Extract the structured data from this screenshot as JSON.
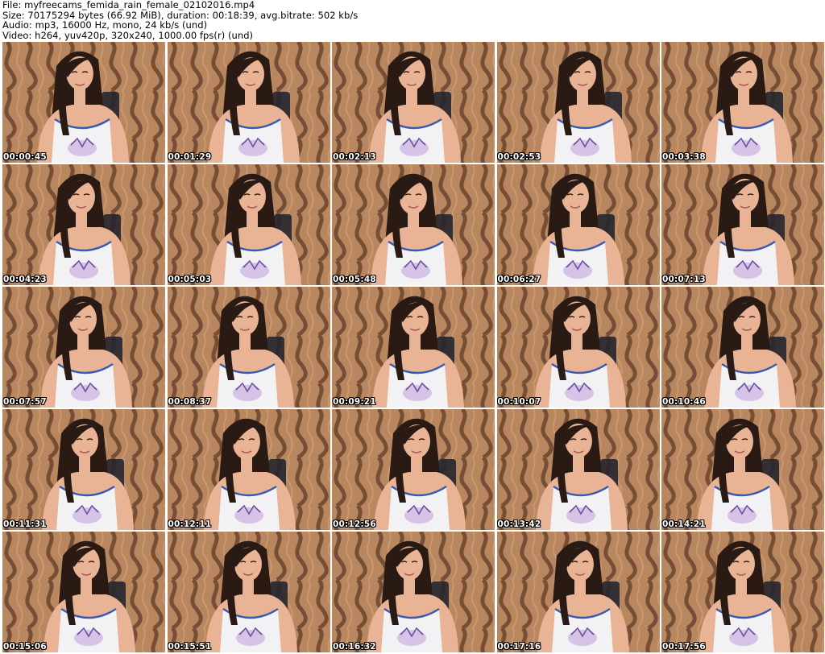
{
  "header": {
    "file_line": "File: myfreecams_femida_rain_female_02102016.mp4",
    "size_line": "Size: 70175294 bytes (66.92 MiB), duration: 00:18:39, avg.bitrate: 502 kb/s",
    "audio_line": "Audio: mp3, 16000 Hz, mono, 24 kb/s (und)",
    "video_line": "Video: h264, yuv420p, 320x240, 1000.00 fps(r) (und)"
  },
  "colors": {
    "wallpaper_base": "#b8865f",
    "wallpaper_stripe": "#5e3a26",
    "hair": "#2a1a14",
    "skin": "#e9b495",
    "shirt": "#f2f2f4",
    "shirt_trim": "#3a5ab0",
    "chair": "#26262e"
  },
  "thumbnails": [
    {
      "timestamp": "00:00:45"
    },
    {
      "timestamp": "00:01:29"
    },
    {
      "timestamp": "00:02:13"
    },
    {
      "timestamp": "00:02:53"
    },
    {
      "timestamp": "00:03:38"
    },
    {
      "timestamp": "00:04:23"
    },
    {
      "timestamp": "00:05:03"
    },
    {
      "timestamp": "00:05:48"
    },
    {
      "timestamp": "00:06:27"
    },
    {
      "timestamp": "00:07:13"
    },
    {
      "timestamp": "00:07:57"
    },
    {
      "timestamp": "00:08:37"
    },
    {
      "timestamp": "00:09:21"
    },
    {
      "timestamp": "00:10:07"
    },
    {
      "timestamp": "00:10:46"
    },
    {
      "timestamp": "00:11:31"
    },
    {
      "timestamp": "00:12:11"
    },
    {
      "timestamp": "00:12:56"
    },
    {
      "timestamp": "00:13:42"
    },
    {
      "timestamp": "00:14:21"
    },
    {
      "timestamp": "00:15:06"
    },
    {
      "timestamp": "00:15:51"
    },
    {
      "timestamp": "00:16:32"
    },
    {
      "timestamp": "00:17:16"
    },
    {
      "timestamp": "00:17:56"
    }
  ]
}
